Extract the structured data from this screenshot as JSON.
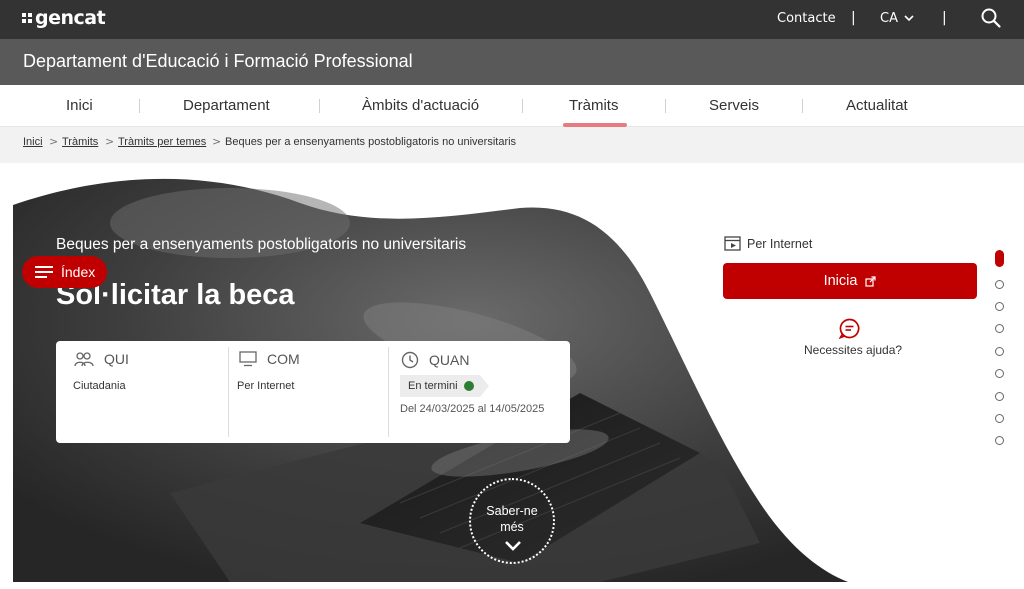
{
  "topbar": {
    "logo": "gencat",
    "contact": "Contacte",
    "separator": "|",
    "language": "CA",
    "icons": {
      "search": "search-icon",
      "lang_chevron": "chevron-down-icon"
    }
  },
  "department": {
    "title": "Departament d'Educació i Formació Professional"
  },
  "nav": {
    "items": [
      {
        "label": "Inici"
      },
      {
        "label": "Departament"
      },
      {
        "label": "Àmbits d'actuació"
      },
      {
        "label": "Tràmits",
        "active": true
      },
      {
        "label": "Serveis"
      },
      {
        "label": "Actualitat"
      }
    ],
    "active_color": "#e87b7f"
  },
  "breadcrumb": {
    "items": [
      {
        "label": "Inici"
      },
      {
        "label": "Tràmits"
      },
      {
        "label": "Tràmits per temes"
      },
      {
        "label": "Beques per a ensenyaments postobligatoris no universitaris"
      }
    ],
    "separator": ">"
  },
  "hero": {
    "subtitle": "Beques per a ensenyaments postobligatoris no universitaris",
    "title": "Sol·licitar la beca",
    "index_button": "Índex",
    "more_button": {
      "line1": "Saber-ne",
      "line2": "més"
    }
  },
  "info_card": {
    "qui": {
      "label": "QUI",
      "value": "Ciutadania",
      "icon": "people-icon"
    },
    "com": {
      "label": "COM",
      "value": "Per Internet",
      "icon": "monitor-icon"
    },
    "quan": {
      "label": "QUAN",
      "icon": "clock-icon",
      "status": "En termini",
      "status_color": "#2e7d32",
      "dates": "Del 24/03/2025 al 14/05/2025"
    }
  },
  "side_panel": {
    "channel": "Per Internet",
    "start_button": "Inicia",
    "help": "Necessites ajuda?",
    "accent": "#c00000"
  },
  "section_nav": {
    "count": 9,
    "active_index": 0
  }
}
